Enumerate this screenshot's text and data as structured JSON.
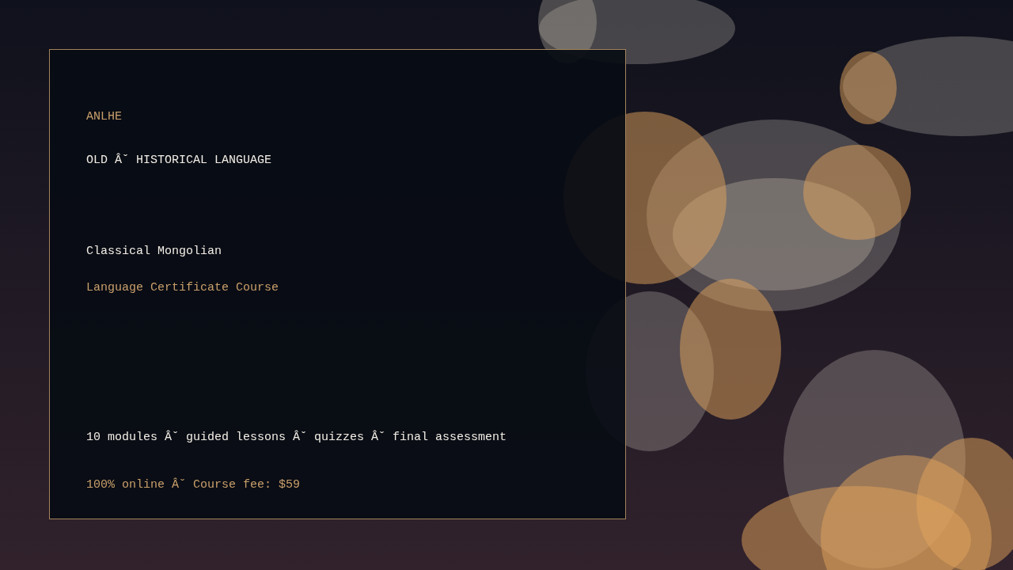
{
  "brand": "ANLHE",
  "category": "OLD Âˇ HISTORICAL LANGUAGE",
  "course": {
    "title": "Classical Mongolian",
    "subtitle": "Language Certificate Course"
  },
  "details": "10 modules Âˇ guided lessons Âˇ quizzes Âˇ final assessment",
  "pricing": "100% online Âˇ Course fee: $59"
}
